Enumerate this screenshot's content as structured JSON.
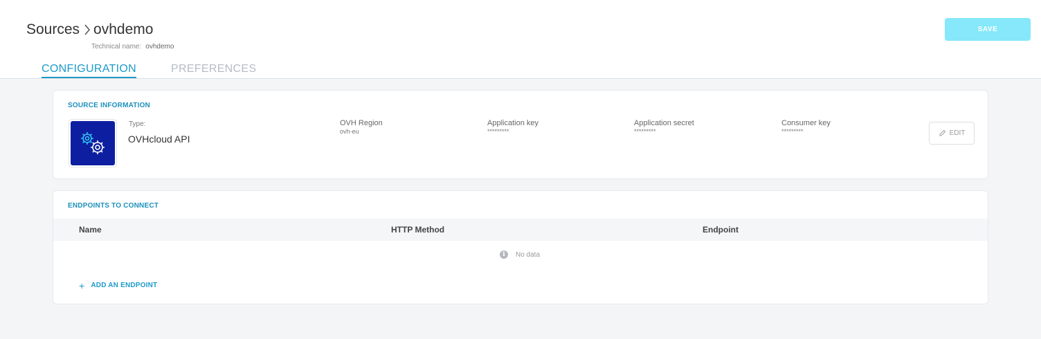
{
  "header": {
    "breadcrumb": {
      "parent": "Sources",
      "current": "ovhdemo"
    },
    "technical_name_label": "Technical name:",
    "technical_name_value": "ovhdemo",
    "save_label": "SAVE"
  },
  "tabs": [
    {
      "label": "CONFIGURATION",
      "active": true
    },
    {
      "label": "PREFERENCES",
      "active": false
    }
  ],
  "source_information": {
    "title": "SOURCE INFORMATION",
    "logo_icon": "gears-icon",
    "type_label": "Type:",
    "type_value": "OVHcloud API",
    "fields": [
      {
        "label": "OVH Region",
        "value": "ovh-eu"
      },
      {
        "label": "Application key",
        "value": "*********"
      },
      {
        "label": "Application secret",
        "value": "*********"
      },
      {
        "label": "Consumer key",
        "value": "*********"
      }
    ],
    "edit_label": "EDIT"
  },
  "endpoints": {
    "title": "ENDPOINTS TO CONNECT",
    "columns": [
      "Name",
      "HTTP Method",
      "Endpoint"
    ],
    "rows": [],
    "empty_text": "No data",
    "add_label": "ADD AN ENDPOINT"
  },
  "colors": {
    "accent": "#1c9ac9",
    "save_button": "#86e8fa",
    "logo_background": "#0d1fa0"
  }
}
